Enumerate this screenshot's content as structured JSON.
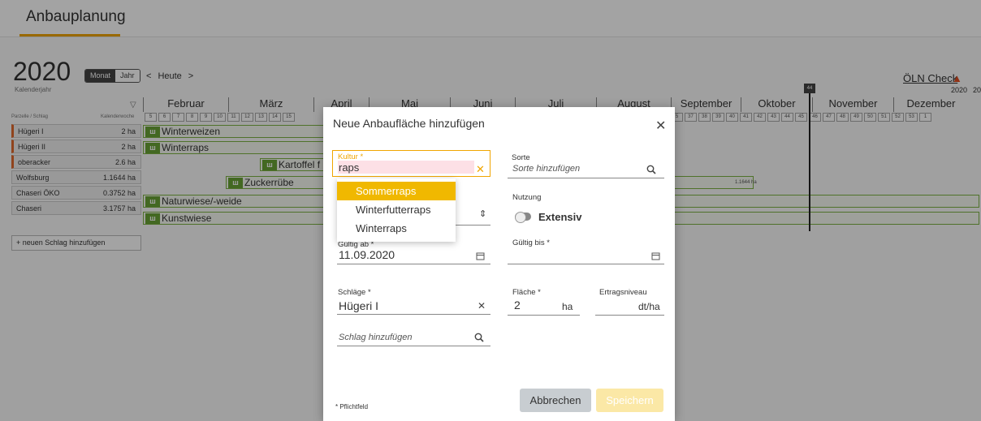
{
  "app": {
    "title": "Anbauplanung"
  },
  "calendar": {
    "year": "2020",
    "year_sub": "Kalenderjahr",
    "view_month": "Monat",
    "view_year": "Jahr",
    "nav_prev": "<",
    "nav_today": "Heute",
    "nav_next": ">",
    "oln_label": "ÖLN Check",
    "oln_year": "2020",
    "oln_year2": "20",
    "today_week": "44",
    "months": [
      "Februar",
      "März",
      "April",
      "Mai",
      "Juni",
      "Juli",
      "August",
      "September",
      "Oktober",
      "November",
      "Dezember"
    ],
    "weeks_left": [
      "5",
      "6",
      "7",
      "8",
      "9",
      "10",
      "11",
      "12",
      "13",
      "14",
      "15"
    ],
    "weeks_right": [
      "5",
      "37",
      "38",
      "39",
      "40",
      "41",
      "42",
      "43",
      "44",
      "45",
      "46",
      "47",
      "48",
      "49",
      "50",
      "51",
      "52",
      "53",
      "1"
    ],
    "col_parcel": "Parzelle / Schlag",
    "col_week": "Kalenderwoche",
    "add_schlag": "+ neuen Schlag hinzufügen",
    "small_label": "1.1644 ha"
  },
  "parcels": [
    {
      "name": "Hügeri I",
      "size": "2 ha"
    },
    {
      "name": "Hügeri II",
      "size": "2 ha"
    },
    {
      "name": "oberacker",
      "size": "2.6 ha"
    },
    {
      "name": "Wolfsburg",
      "size": "1.1644 ha"
    },
    {
      "name": "Chaseri ÖKO",
      "size": "0.3752 ha"
    },
    {
      "name": "Chaseri",
      "size": "3.1757 ha"
    }
  ],
  "crops": {
    "winterweizen": "Winterweizen",
    "winterraps": "Winterraps",
    "kartoffel": "Kartoffel f",
    "zuckerruebe": "Zuckerrübe",
    "naturwiese": "Naturwiese/-weide",
    "kunstwiese": "Kunstwiese"
  },
  "modal": {
    "title": "Neue Anbaufläche hinzufügen",
    "kultur_label": "Kultur *",
    "kultur_value": "raps",
    "sorte_label": "Sorte",
    "sorte_placeholder": "Sorte hinzufügen",
    "nutzung_label": "Nutzung",
    "nutzung_toggle": "Extensiv",
    "gueltig_ab_label": "Gültig ab *",
    "gueltig_ab_value": "11.09.2020",
    "gueltig_bis_label": "Gültig bis *",
    "schlaege_label": "Schläge *",
    "schlaege_value": "Hügeri I",
    "flaeche_label": "Fläche *",
    "flaeche_value": "2",
    "flaeche_unit": "ha",
    "ertrag_label": "Ertragsniveau",
    "ertrag_unit": "dt/ha",
    "schlag_placeholder": "Schlag hinzufügen",
    "required_note": "* Pflichtfeld",
    "cancel": "Abbrechen",
    "save": "Speichern",
    "hidden_label_fragment": "H",
    "dropdown": [
      "Sommerraps",
      "Winterfutterraps",
      "Winterraps"
    ]
  },
  "colors": {
    "accent": "#f0a500",
    "selected": "#f0b800",
    "warning": "#e24b1e",
    "crop": "#6aa336"
  }
}
